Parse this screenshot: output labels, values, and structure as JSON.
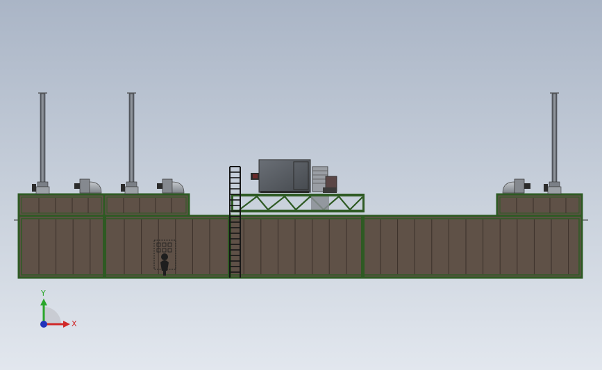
{
  "scene": {
    "background_top": "#aab5c6",
    "background_bottom": "#e2e7ee"
  },
  "colors": {
    "frame_green": "#2e5a23",
    "panel_brown": "#5f5147",
    "panel_line": "#3a302a",
    "steel_dark": "#2b2b2b",
    "stack_grey": "#6d7178",
    "equipment_grey": "#575b61",
    "fan_grey": "#8f9399"
  },
  "triad": {
    "y_label": "Y",
    "x_label": "X",
    "y_color": "#2aa62a",
    "x_color": "#d02828",
    "z_color": "#2233bb"
  }
}
